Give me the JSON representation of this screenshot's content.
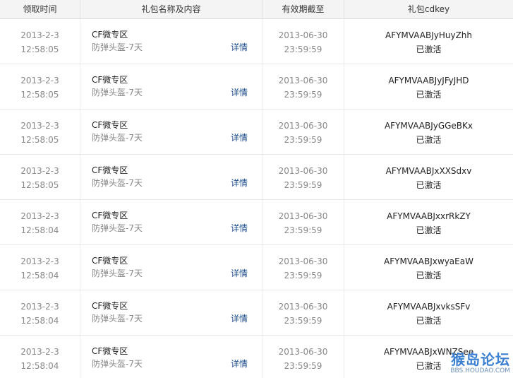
{
  "header": {
    "col_time": "领取时间",
    "col_gift": "礼包名称及内容",
    "col_expire": "有效期截至",
    "col_key": "礼包cdkey"
  },
  "rows": [
    {
      "date": "2013-2-3",
      "time": "12:58:05",
      "gift_name": "CF微专区",
      "gift_content": "防弹头盔-7天",
      "detail": "详情",
      "expire_date": "2013-06-30",
      "expire_time": "23:59:59",
      "cdkey": "AFYMVAABJyHuyZhh",
      "status": "已激活"
    },
    {
      "date": "2013-2-3",
      "time": "12:58:05",
      "gift_name": "CF微专区",
      "gift_content": "防弹头盔-7天",
      "detail": "详情",
      "expire_date": "2013-06-30",
      "expire_time": "23:59:59",
      "cdkey": "AFYMVAABJyJFyJHD",
      "status": "已激活"
    },
    {
      "date": "2013-2-3",
      "time": "12:58:05",
      "gift_name": "CF微专区",
      "gift_content": "防弹头盔-7天",
      "detail": "详情",
      "expire_date": "2013-06-30",
      "expire_time": "23:59:59",
      "cdkey": "AFYMVAABJyGGeBKx",
      "status": "已激活"
    },
    {
      "date": "2013-2-3",
      "time": "12:58:05",
      "gift_name": "CF微专区",
      "gift_content": "防弹头盔-7天",
      "detail": "详情",
      "expire_date": "2013-06-30",
      "expire_time": "23:59:59",
      "cdkey": "AFYMVAABJxXXSdxv",
      "status": "已激活"
    },
    {
      "date": "2013-2-3",
      "time": "12:58:04",
      "gift_name": "CF微专区",
      "gift_content": "防弹头盔-7天",
      "detail": "详情",
      "expire_date": "2013-06-30",
      "expire_time": "23:59:59",
      "cdkey": "AFYMVAABJxxrRkZY",
      "status": "已激活"
    },
    {
      "date": "2013-2-3",
      "time": "12:58:04",
      "gift_name": "CF微专区",
      "gift_content": "防弹头盔-7天",
      "detail": "详情",
      "expire_date": "2013-06-30",
      "expire_time": "23:59:59",
      "cdkey": "AFYMVAABJxwyaEaW",
      "status": "已激活"
    },
    {
      "date": "2013-2-3",
      "time": "12:58:04",
      "gift_name": "CF微专区",
      "gift_content": "防弹头盔-7天",
      "detail": "详情",
      "expire_date": "2013-06-30",
      "expire_time": "23:59:59",
      "cdkey": "AFYMVAABJxvksSFv",
      "status": "已激活"
    },
    {
      "date": "2013-2-3",
      "time": "12:58:04",
      "gift_name": "CF微专区",
      "gift_content": "防弹头盔-7天",
      "detail": "详情",
      "expire_date": "2013-06-30",
      "expire_time": "23:59:59",
      "cdkey": "AFYMVAABJxWNZSee",
      "status": "已激活"
    }
  ],
  "watermark": {
    "title": "猴岛论坛",
    "subtitle": "BBS.HOUDAO.COM"
  }
}
